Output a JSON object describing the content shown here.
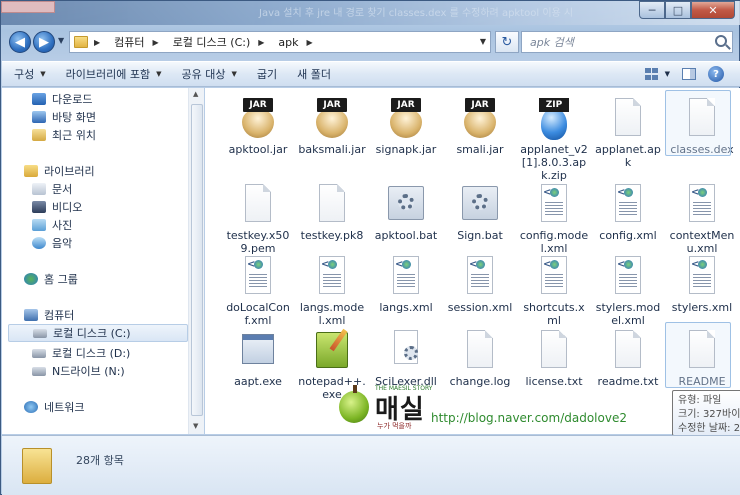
{
  "window": {
    "background_text": "Java 설치 후 jre 내 경로 찾기 classes.dex 를 수정하려 apktool 이용 시",
    "controls": {
      "minimize": "─",
      "maximize": "□",
      "close": "✕"
    }
  },
  "address": {
    "breadcrumbs": [
      "컴퓨터",
      "로컬 디스크 (C:)",
      "apk"
    ],
    "search_placeholder": "apk 검색"
  },
  "toolbar": {
    "organize": "구성",
    "include_library": "라이브러리에 포함",
    "share": "공유 대상",
    "burn": "굽기",
    "new_folder": "새 폴더"
  },
  "nav": {
    "favorites": [
      {
        "label": "다운로드",
        "icon": "download-folder-icon"
      },
      {
        "label": "바탕 화면",
        "icon": "desktop-icon"
      },
      {
        "label": "최근 위치",
        "icon": "recent-places-icon"
      }
    ],
    "libraries_label": "라이브러리",
    "libraries": [
      {
        "label": "문서",
        "icon": "documents-icon"
      },
      {
        "label": "비디오",
        "icon": "videos-icon"
      },
      {
        "label": "사진",
        "icon": "pictures-icon"
      },
      {
        "label": "음악",
        "icon": "music-icon"
      }
    ],
    "homegroup_label": "홈 그룹",
    "computer_label": "컴퓨터",
    "drives": [
      {
        "label": "로컬 디스크 (C:)",
        "selected": true
      },
      {
        "label": "로컬 디스크 (D:)",
        "selected": false
      },
      {
        "label": "N드라이브 (N:)",
        "selected": false
      }
    ],
    "network_label": "네트워크"
  },
  "files": [
    {
      "name": "apktool.jar",
      "type": "jar"
    },
    {
      "name": "baksmali.jar",
      "type": "jar"
    },
    {
      "name": "signapk.jar",
      "type": "jar"
    },
    {
      "name": "smali.jar",
      "type": "jar"
    },
    {
      "name": "applanet_v2[1].8.0.3.apk.zip",
      "type": "zip"
    },
    {
      "name": "applanet.apk",
      "type": "doc"
    },
    {
      "name": "classes.dex",
      "type": "doc",
      "highlight": true
    },
    {
      "name": "testkey.x509.pem",
      "type": "doc"
    },
    {
      "name": "testkey.pk8",
      "type": "doc"
    },
    {
      "name": "apktool.bat",
      "type": "bat"
    },
    {
      "name": "Sign.bat",
      "type": "bat"
    },
    {
      "name": "config.model.xml",
      "type": "xml"
    },
    {
      "name": "config.xml",
      "type": "xml"
    },
    {
      "name": "contextMenu.xml",
      "type": "xml"
    },
    {
      "name": "doLocalConf.xml",
      "type": "xml"
    },
    {
      "name": "langs.model.xml",
      "type": "xml"
    },
    {
      "name": "langs.xml",
      "type": "xml"
    },
    {
      "name": "session.xml",
      "type": "xml"
    },
    {
      "name": "shortcuts.xml",
      "type": "xml"
    },
    {
      "name": "stylers.model.xml",
      "type": "xml"
    },
    {
      "name": "stylers.xml",
      "type": "xml"
    },
    {
      "name": "aapt.exe",
      "type": "exe"
    },
    {
      "name": "notepad++.exe",
      "type": "npp"
    },
    {
      "name": "SciLexer.dll",
      "type": "dll"
    },
    {
      "name": "change.log",
      "type": "doc"
    },
    {
      "name": "license.txt",
      "type": "doc"
    },
    {
      "name": "readme.txt",
      "type": "doc"
    },
    {
      "name": "README",
      "type": "doc",
      "highlight": true
    }
  ],
  "labels": {
    "t0": "JAR",
    "t1": "ZIP"
  },
  "tooltip": {
    "type": "유형: 파일",
    "size": "크기: 327바이",
    "modified": "수정한 날짜: 2"
  },
  "watermark": {
    "brand": "매실",
    "brand_top": "THE MAESIL STORY",
    "brand_sub": "누가 먹을까",
    "url": "http://blog.naver.com/dadolove2"
  },
  "status": {
    "item_count": "28개 항목"
  }
}
